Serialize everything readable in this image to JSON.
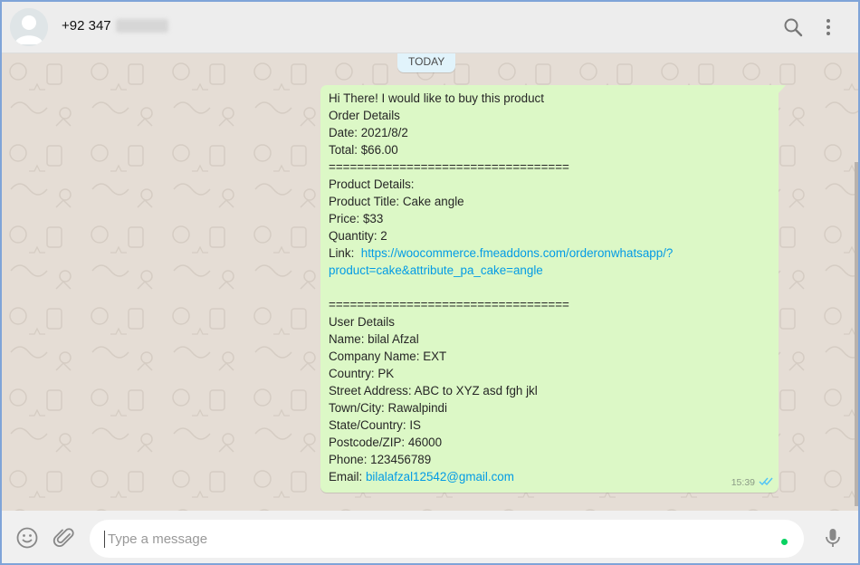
{
  "header": {
    "contact_name": "+92 347",
    "icons": [
      "search-icon",
      "menu-icon"
    ]
  },
  "chat": {
    "date_badge": "TODAY",
    "message": {
      "lines": [
        "Hi There! I would like to buy this product",
        "Order Details",
        "Date:  2021/8/2",
        "Total: $66.00",
        "==================================",
        "Product Details:",
        "Product Title:  Cake angle",
        "Price: $33",
        "Quantity:  2",
        "Link:",
        "https://woocommerce.fmeaddons.com/orderonwhatsapp/?",
        "product=cake&attribute_pa_cake=angle",
        "",
        "==================================",
        "User Details",
        "Name: bilal Afzal",
        "Company Name: EXT",
        "Country: PK",
        "Street Address: ABC to XYZ asd fgh jkl",
        "Town/City: Rawalpindi",
        "State/Country: IS",
        "Postcode/ZIP: 46000",
        "Phone: 123456789",
        "Email:",
        "bilalafzal12542@gmail.com"
      ],
      "time": "15:39",
      "status": "read"
    }
  },
  "footer": {
    "input_placeholder": "Type a message",
    "icons": [
      "emoji-icon",
      "attach-icon",
      "mic-icon"
    ]
  },
  "colors": {
    "outgoing_bubble": "#dcf8c6",
    "link": "#039be5",
    "date_badge": "#e1f3fb",
    "chat_background": "#e5ddd5",
    "read_ticks": "#4fc3f7"
  }
}
